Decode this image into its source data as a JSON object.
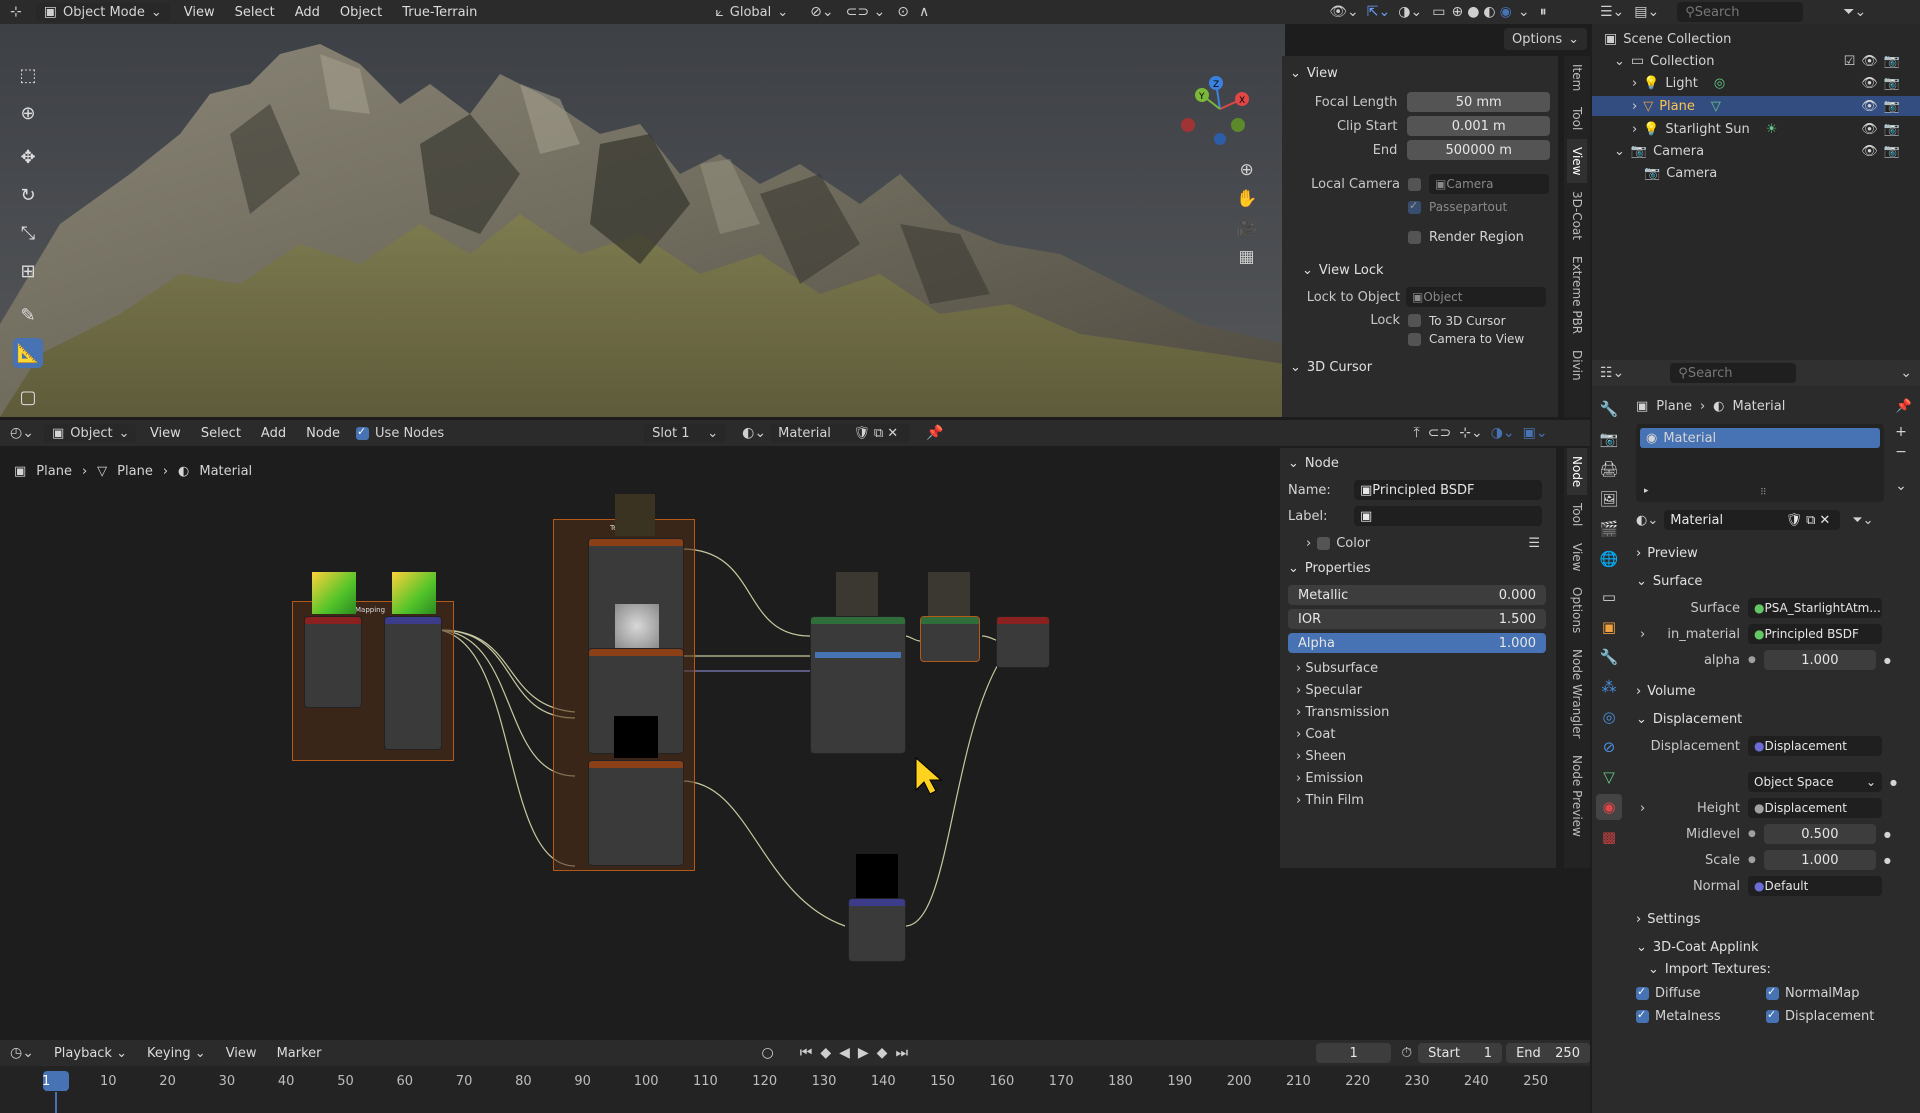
{
  "topbar": {
    "mode": "Object Mode",
    "menus": [
      "View",
      "Select",
      "Add",
      "Object",
      "True-Terrain"
    ],
    "orientation": "Global",
    "options": "Options"
  },
  "viewport_panel": {
    "view_header": "View",
    "focal_length_label": "Focal Length",
    "focal_length": "50 mm",
    "clip_start_label": "Clip Start",
    "clip_start": "0.001 m",
    "end_label": "End",
    "end": "500000 m",
    "local_camera_label": "Local Camera",
    "camera_placeholder": "Camera",
    "passepartout": "Passepartout",
    "render_region": "Render Region",
    "view_lock_header": "View Lock",
    "lock_to_object_label": "Lock to Object",
    "object_placeholder": "Object",
    "lock_label": "Lock",
    "to_3d_cursor": "To 3D Cursor",
    "camera_to_view": "Camera to View",
    "cursor_header": "3D Cursor",
    "tabs": [
      "Item",
      "Tool",
      "View",
      "3D-Coat",
      "Extreme PBR",
      "Divin"
    ]
  },
  "outliner": {
    "search": "Search",
    "scene_collection": "Scene Collection",
    "items": [
      {
        "name": "Collection",
        "indent": 1
      },
      {
        "name": "Light",
        "indent": 2
      },
      {
        "name": "Plane",
        "indent": 2
      },
      {
        "name": "Starlight Sun",
        "indent": 2
      },
      {
        "name": "Camera",
        "indent": 1
      },
      {
        "name": "Camera",
        "indent": 2
      }
    ]
  },
  "node_editor": {
    "header_menus": [
      "View",
      "Select",
      "Add",
      "Node"
    ],
    "editor_type": "Object",
    "use_nodes": "Use Nodes",
    "slot": "Slot 1",
    "material": "Material",
    "breadcrumb": [
      "Plane",
      "Plane",
      "Material"
    ],
    "frame_mapping_label": "Mapping",
    "frame_tex_label": "Te",
    "tabs": [
      "Node",
      "Tool",
      "View",
      "Options",
      "Node Wrangler",
      "Node Preview"
    ]
  },
  "node_panel": {
    "node_header": "Node",
    "name_label": "Name:",
    "name_value": "Principled BSDF",
    "label_label": "Label:",
    "color_label": "Color",
    "properties_header": "Properties",
    "metallic_label": "Metallic",
    "metallic": "0.000",
    "ior_label": "IOR",
    "ior": "1.500",
    "alpha_label": "Alpha",
    "alpha": "1.000",
    "subsections": [
      "Subsurface",
      "Specular",
      "Transmission",
      "Coat",
      "Sheen",
      "Emission",
      "Thin Film"
    ]
  },
  "properties": {
    "search": "Search",
    "breadcrumb_object": "Plane",
    "breadcrumb_material": "Material",
    "material_slot": "Material",
    "material_name": "Material",
    "preview": "Preview",
    "surface_header": "Surface",
    "surface_label": "Surface",
    "surface_value": "PSA_StarlightAtm...",
    "in_material_label": "in_material",
    "in_material_value": "Principled BSDF",
    "alpha_label": "alpha",
    "alpha_value": "1.000",
    "volume": "Volume",
    "displacement_header": "Displacement",
    "displacement_label": "Displacement",
    "displacement_value": "Displacement",
    "space": "Object Space",
    "height_label": "Height",
    "height_value": "Displacement",
    "midlevel_label": "Midlevel",
    "midlevel_value": "0.500",
    "scale_label": "Scale",
    "scale_value": "1.000",
    "normal_label": "Normal",
    "normal_value": "Default",
    "settings": "Settings",
    "coat_applink": "3D-Coat Applink",
    "import_textures": "Import Textures:",
    "diffuse": "Diffuse",
    "normalmap": "NormalMap",
    "metalness": "Metalness",
    "displacement_cb": "Displacement"
  },
  "timeline": {
    "menus": [
      "Playback",
      "Keying",
      "View",
      "Marker"
    ],
    "current_frame": "1",
    "start_label": "Start",
    "start": "1",
    "end_label": "End",
    "end": "250",
    "ruler": [
      "1",
      "10",
      "20",
      "30",
      "40",
      "50",
      "60",
      "70",
      "80",
      "90",
      "100",
      "110",
      "120",
      "130",
      "140",
      "150",
      "160",
      "170",
      "180",
      "190",
      "200",
      "210",
      "220",
      "230",
      "240",
      "250"
    ]
  },
  "colors": {
    "accent": "#4772b3",
    "frame_border": "#b35a1a",
    "node_header_texture": "#8a3f17",
    "node_header_shader": "#2f6d3a",
    "node_header_vector": "#3c3c8a",
    "node_header_output": "#8a2020",
    "cursor": "#ffd21f"
  }
}
